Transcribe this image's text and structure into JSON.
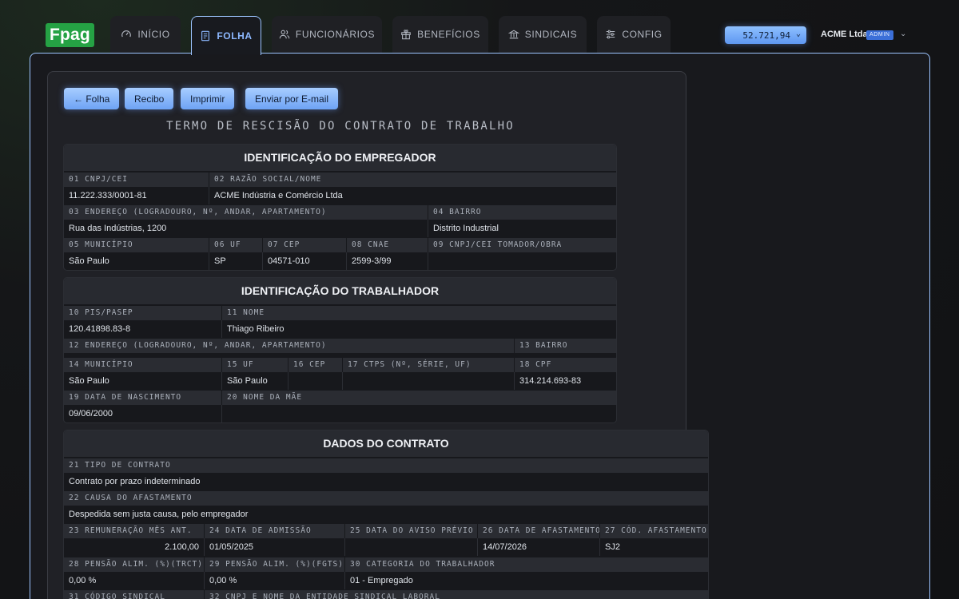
{
  "app": {
    "logo": "Fpag"
  },
  "nav": {
    "tabs": [
      {
        "label": "INÍCIO",
        "icon": "gauge-icon"
      },
      {
        "label": "FOLHA",
        "icon": "document-icon",
        "active": true
      },
      {
        "label": "FUNCIONÁRIOS",
        "icon": "users-icon"
      },
      {
        "label": "BENEFÍCIOS",
        "icon": "gift-icon"
      },
      {
        "label": "SINDICAIS",
        "icon": "bank-icon"
      },
      {
        "label": "CONFIG",
        "icon": "sliders-icon"
      }
    ]
  },
  "header": {
    "balance": "52.721,94",
    "company": "ACME Ltda",
    "role": "ADMIN"
  },
  "actions": {
    "back": "← Folha",
    "receipt": "Recibo",
    "print": "Imprimir",
    "email": "Enviar por E-mail"
  },
  "document": {
    "title": "TERMO DE RESCISÃO DO CONTRATO DE TRABALHO"
  },
  "employer": {
    "title": "IDENTIFICAÇÃO DO EMPREGADOR",
    "f01_label": "01 CNPJ/CEI",
    "f01": "11.222.333/0001-81",
    "f02_label": "02 RAZÃO SOCIAL/NOME",
    "f02": "ACME Indústria e Comércio Ltda",
    "f03_label": "03 ENDEREÇO (LOGRADOURO, Nº, ANDAR, APARTAMENTO)",
    "f03": "Rua das Indústrias, 1200",
    "f04_label": "04 BAIRRO",
    "f04": "Distrito Industrial",
    "f05_label": "05 MUNICÍPIO",
    "f05": "São Paulo",
    "f06_label": "06 UF",
    "f06": "SP",
    "f07_label": "07 CEP",
    "f07": "04571-010",
    "f08_label": "08 CNAE",
    "f08": "2599-3/99",
    "f09_label": "09 CNPJ/CEI TOMADOR/OBRA",
    "f09": ""
  },
  "worker": {
    "title": "IDENTIFICAÇÃO DO TRABALHADOR",
    "f10_label": "10 PIS/PASEP",
    "f10": "120.41898.83-8",
    "f11_label": "11 NOME",
    "f11": "Thiago Ribeiro",
    "f12_label": "12 ENDEREÇO (LOGRADOURO, Nº, ANDAR, APARTAMENTO)",
    "f13_label": "13 BAIRRO",
    "f14_label": "14 MUNICÍPIO",
    "f14": "São Paulo",
    "f15_label": "15 UF",
    "f15": "São Paulo",
    "f16_label": "16 CEP",
    "f16": "",
    "f17_label": "17 CTPS (Nº, SÉRIE, UF)",
    "f17": "",
    "f18_label": "18 CPF",
    "f18": "314.214.693-83",
    "f19_label": "19 DATA DE NASCIMENTO",
    "f19": "09/06/2000",
    "f20_label": "20 NOME DA MÃE",
    "f20": ""
  },
  "contract": {
    "title": "DADOS DO CONTRATO",
    "f21_label": "21 TIPO DE CONTRATO",
    "f21": "Contrato por prazo indeterminado",
    "f22_label": "22 CAUSA DO AFASTAMENTO",
    "f22": "Despedida sem justa causa, pelo empregador",
    "f23_label": "23 REMUNERAÇÃO MÊS ANT.",
    "f23": "2.100,00",
    "f24_label": "24 DATA DE ADMISSÃO",
    "f24": "01/05/2025",
    "f25_label": "25 DATA DO AVISO PRÉVIO",
    "f25": "",
    "f26_label": "26 DATA DE AFASTAMENTO",
    "f26": "14/07/2026",
    "f27_label": "27 CÓD. AFASTAMENTO",
    "f27": "SJ2",
    "f28_label": "28 PENSÃO ALIM. (%)(TRCT)",
    "f28": "0,00 %",
    "f29_label": "29 PENSÃO ALIM. (%)(FGTS)",
    "f29": "0,00 %",
    "f30_label": "30 CATEGORIA DO TRABALHADOR",
    "f30": "01 - Empregado",
    "f31_label": "31 CÓDIGO SINDICAL",
    "f32_label": "32 CNPJ E NOME DA ENTIDADE SINDICAL LABORAL"
  }
}
